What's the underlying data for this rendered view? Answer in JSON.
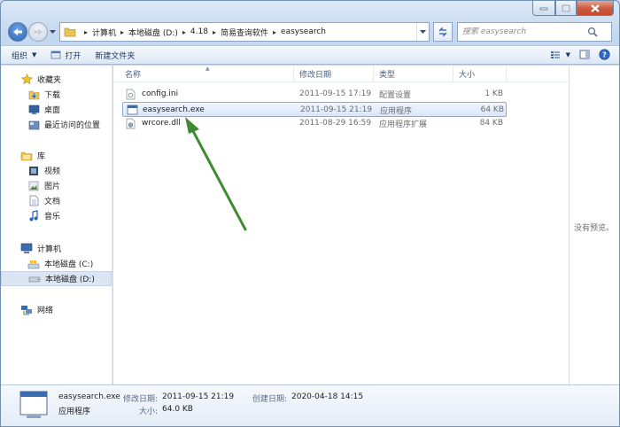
{
  "breadcrumb": [
    "计算机",
    "本地磁盘 (D:)",
    "4.18",
    "简易查询软件",
    "easysearch"
  ],
  "search": {
    "placeholder": "搜索 easysearch"
  },
  "toolbar": {
    "organize": "组织",
    "open": "打开",
    "new_folder": "新建文件夹"
  },
  "nav": {
    "favorites": "收藏夹",
    "downloads": "下载",
    "desktop": "桌面",
    "recent": "最近访问的位置",
    "libraries": "库",
    "videos": "视频",
    "pictures": "图片",
    "documents": "文档",
    "music": "音乐",
    "computer": "计算机",
    "drive_c": "本地磁盘 (C:)",
    "drive_d": "本地磁盘 (D:)",
    "network": "网络"
  },
  "columns": {
    "name": "名称",
    "date": "修改日期",
    "type": "类型",
    "size": "大小"
  },
  "files": [
    {
      "name": "config.ini",
      "date": "2011-09-15 17:19",
      "type": "配置设置",
      "size": "1 KB",
      "icon": "ini-file-icon"
    },
    {
      "name": "easysearch.exe",
      "date": "2011-09-15 21:19",
      "type": "应用程序",
      "size": "64 KB",
      "icon": "exe-file-icon",
      "selected": true
    },
    {
      "name": "wrcore.dll",
      "date": "2011-08-29 16:59",
      "type": "应用程序扩展",
      "size": "84 KB",
      "icon": "dll-file-icon"
    }
  ],
  "preview": {
    "message": "没有预览。"
  },
  "details": {
    "name": "easysearch.exe",
    "type": "应用程序",
    "modified_label": "修改日期:",
    "modified_value": "2011-09-15 21:19",
    "created_label": "创建日期:",
    "created_value": "2020-04-18 14:15",
    "size_label": "大小:",
    "size_value": "64.0 KB"
  },
  "colors": {
    "selection": "#d9e7fa",
    "selection_border": "#84acdd",
    "annotation_arrow": "#3f8a32"
  }
}
